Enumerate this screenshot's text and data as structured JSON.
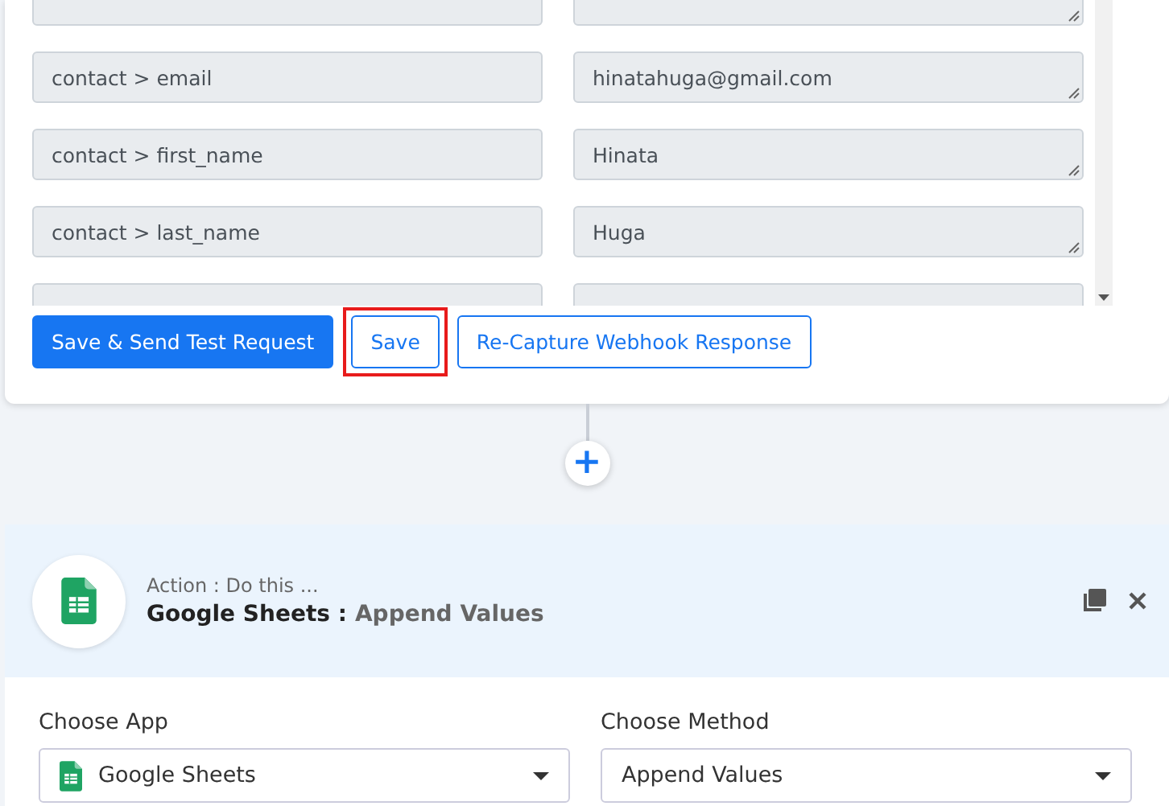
{
  "response_rows": [
    {
      "clipped": true
    },
    {
      "key": "contact > email",
      "value": "hinatahuga@gmail.com"
    },
    {
      "key": "contact > first_name",
      "value": "Hinata"
    },
    {
      "key": "contact > last_name",
      "value": "Huga"
    },
    {
      "clipped": true
    }
  ],
  "buttons": [
    {
      "label": "Save & Send Test Request",
      "kind": "primary",
      "highlighted": false
    },
    {
      "label": "Save",
      "kind": "outline",
      "highlighted": true
    },
    {
      "label": "Re-Capture Webhook Response",
      "kind": "outline",
      "highlighted": false
    }
  ],
  "add_step": {
    "label": "+"
  },
  "action": {
    "subtitle": "Action : Do this ...",
    "app": "Google Sheets :",
    "method": "Append Values",
    "fields": [
      {
        "label": "Choose App",
        "value": "Google Sheets",
        "app_icon": true
      },
      {
        "label": "Choose Method",
        "value": "Append Values",
        "app_icon": false
      }
    ]
  }
}
